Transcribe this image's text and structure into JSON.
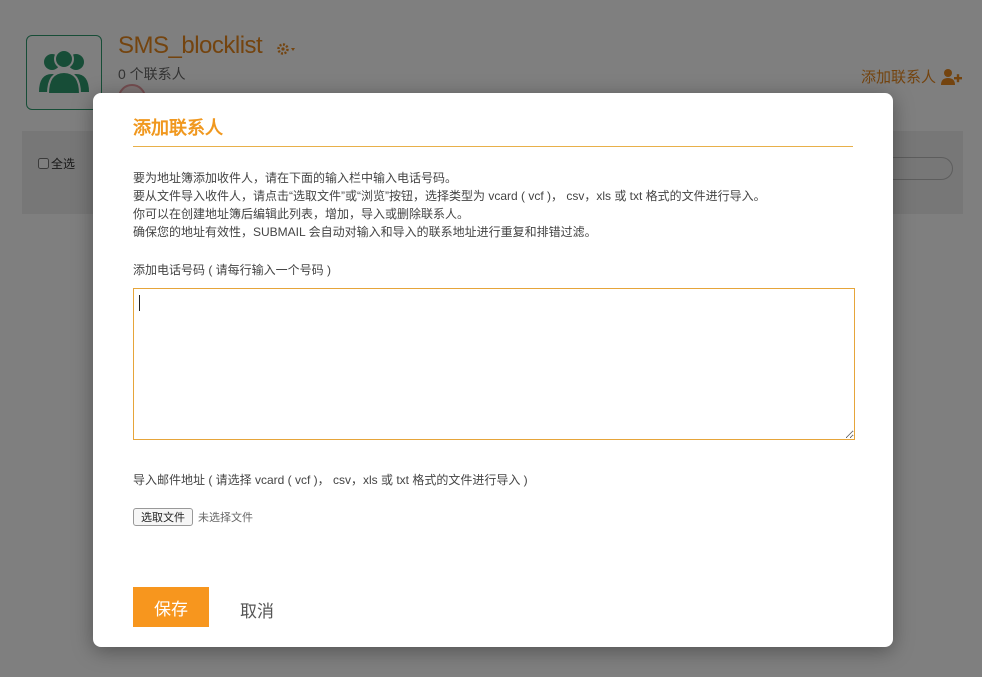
{
  "header": {
    "list_title": "SMS_blocklist",
    "contact_count": "0 个联系人",
    "add_contact_label": "添加联系人"
  },
  "toolbar": {
    "select_all_label": "全选"
  },
  "modal": {
    "title": "添加联系人",
    "instructions": [
      "要为地址簿添加收件人，请在下面的输入栏中输入电话号码。",
      "要从文件导入收件人，请点击“选取文件”或“浏览”按钮，选择类型为 vcard ( vcf )， csv，xls 或 txt 格式的文件进行导入。",
      "你可以在创建地址簿后编辑此列表，增加，导入或删除联系人。",
      "确保您的地址有效性，SUBMAIL 会自动对输入和导入的联系地址进行重复和排错过滤。"
    ],
    "phone_label": "添加电话号码 ( 请每行输入一个号码 )",
    "phone_value": "",
    "email_label": "导入邮件地址 ( 请选择 vcard ( vcf )， csv，xls 或 txt 格式的文件进行导入 )",
    "file_button_label": "选取文件",
    "file_status": "未选择文件",
    "save_label": "保存",
    "cancel_label": "取消"
  },
  "colors": {
    "accent": "#f7961e",
    "title_orange": "#e8891f",
    "avatar_green": "#2f9a6f",
    "overlay": "rgba(0,0,0,0.5)"
  },
  "icons": {
    "avatar": "group-users-icon",
    "settings": "gear-icon",
    "add_contact": "add-user-icon"
  }
}
